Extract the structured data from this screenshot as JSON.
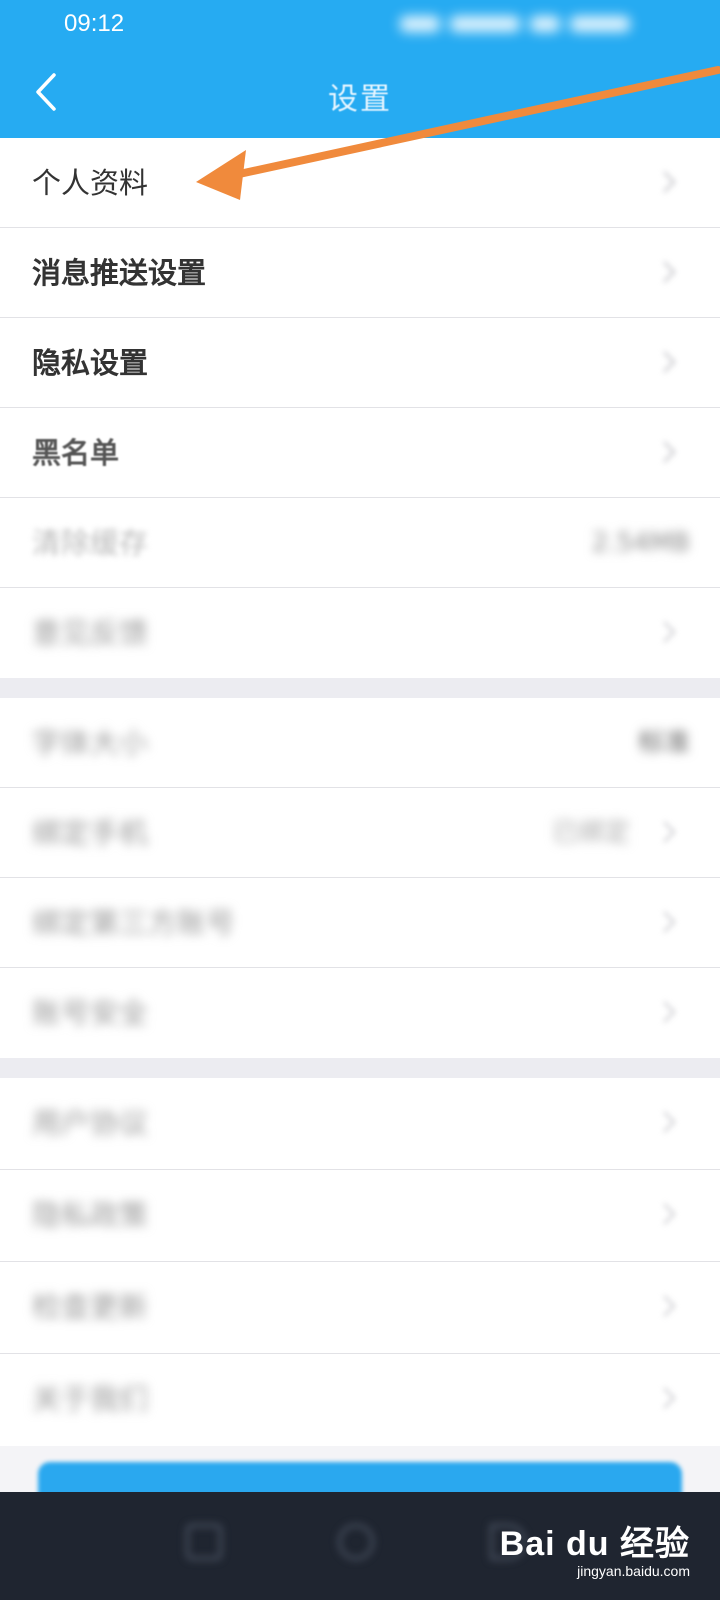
{
  "status_bar": {
    "time": "09:12"
  },
  "header": {
    "title": "设置"
  },
  "groups": [
    [
      {
        "label": "个人资料",
        "blurred": false,
        "bold": false
      },
      {
        "label": "消息推送设置",
        "blurred": false,
        "bold": true
      },
      {
        "label": "隐私设置",
        "blurred": false,
        "bold": true
      },
      {
        "label": "黑名单",
        "blurred": false,
        "bold": true
      },
      {
        "label": "清除缓存",
        "blurred": true,
        "value": "2.54MB"
      },
      {
        "label": "意见反馈",
        "blurred": true
      }
    ],
    [
      {
        "label": "字体大小",
        "blurred": true,
        "value": "标准"
      },
      {
        "label": "绑定手机",
        "blurred": true,
        "value": "已绑定"
      },
      {
        "label": "绑定第三方账号",
        "blurred": true
      },
      {
        "label": "账号安全",
        "blurred": true
      }
    ],
    [
      {
        "label": "用户协议",
        "blurred": true
      },
      {
        "label": "隐私政策",
        "blurred": true
      },
      {
        "label": "检查更新",
        "blurred": true
      },
      {
        "label": "关于我们",
        "blurred": true
      }
    ]
  ],
  "watermark": {
    "brand": "Bai du 经验",
    "url": "jingyan.baidu.com"
  },
  "colors": {
    "header": "#26abf2",
    "annotation_arrow": "#f08a3c",
    "nav_bar": "#1f2530"
  }
}
